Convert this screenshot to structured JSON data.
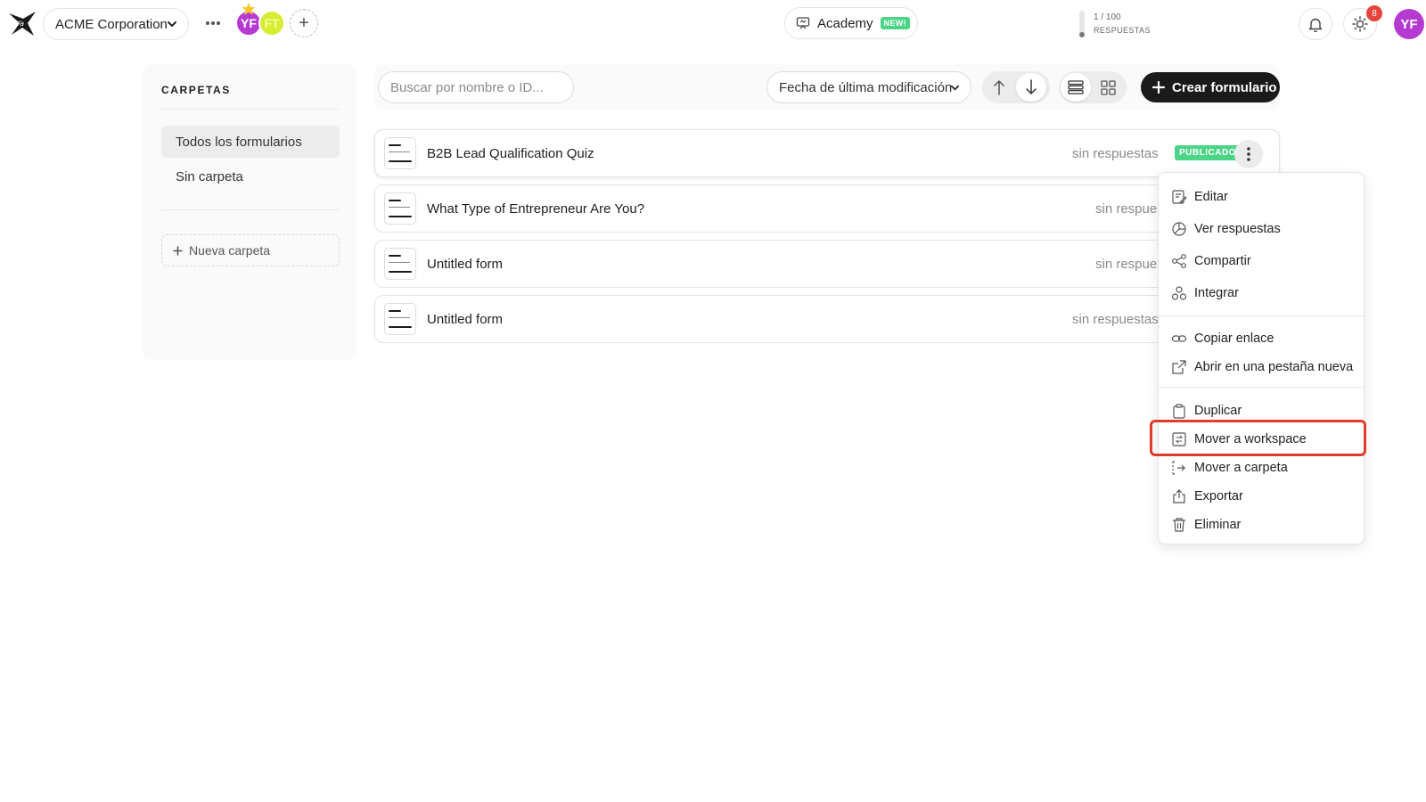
{
  "topbar": {
    "workspace_name": "ACME Corporation",
    "more_icon": "more-dots-icon",
    "members": [
      {
        "initials": "YF",
        "color": "#b53ad1",
        "owner": true
      },
      {
        "initials": "FT",
        "color": "#d6ed33"
      }
    ],
    "add_member_symbol": "+",
    "academy_label": "Academy",
    "academy_badge": "NEW!",
    "usage_count": "1 / 100",
    "usage_label": "RESPUESTAS",
    "usage_fraction": 0.01,
    "notifications_icon": "bell-icon",
    "theme_icon": "sun-icon",
    "updates_badge": "8",
    "user_initials": "YF"
  },
  "sidebar": {
    "title": "CARPETAS",
    "items": [
      {
        "label": "Todos los formularios",
        "active": true
      },
      {
        "label": "Sin carpeta",
        "active": false
      }
    ],
    "new_folder_label": "Nueva carpeta"
  },
  "toolbar": {
    "search_placeholder": "Buscar por nombre o ID...",
    "sort_label": "Fecha de última modificación",
    "create_label": "Crear formulario"
  },
  "forms": [
    {
      "name": "B2B Lead Qualification Quiz",
      "responses": "sin respuestas",
      "status": "PUBLICADO"
    },
    {
      "name": "What Type of Entrepreneur Are You?",
      "responses": "sin respuestas"
    },
    {
      "name": "Untitled form",
      "responses": "sin respuestas"
    },
    {
      "name": "Untitled form",
      "responses": "sin respuestas"
    }
  ],
  "context_menu": {
    "items": [
      {
        "label": "Editar",
        "icon": "edit-icon"
      },
      {
        "label": "Ver respuestas",
        "icon": "pie-chart-icon"
      },
      {
        "label": "Compartir",
        "icon": "share-icon"
      },
      {
        "label": "Integrar",
        "icon": "integrate-icon"
      },
      {
        "label": "Copiar enlace",
        "icon": "link-icon"
      },
      {
        "label": "Abrir en una pestaña nueva",
        "icon": "external-link-icon"
      },
      {
        "label": "Duplicar",
        "icon": "duplicate-icon"
      },
      {
        "label": "Mover a workspace",
        "icon": "move-workspace-icon",
        "highlighted": true
      },
      {
        "label": "Mover a carpeta",
        "icon": "move-folder-icon"
      },
      {
        "label": "Exportar",
        "icon": "export-icon"
      },
      {
        "label": "Eliminar",
        "icon": "trash-icon"
      }
    ]
  },
  "colors": {
    "accent_dark": "#1a1a1a",
    "published_green": "#4cd487",
    "avatar_purple": "#b53ad1",
    "highlight_red": "#e03b2c"
  }
}
